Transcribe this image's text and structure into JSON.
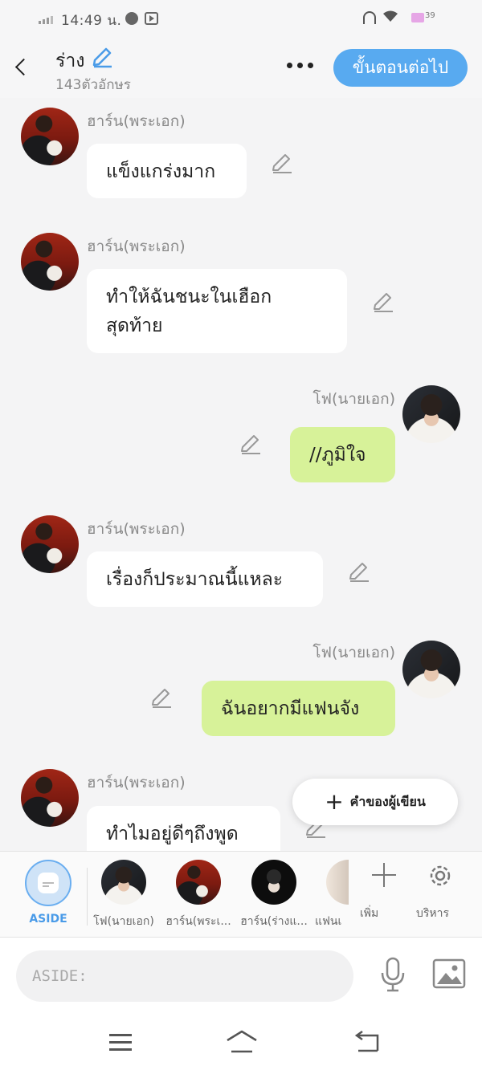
{
  "status_bar": {
    "time": "14:49 น.",
    "battery": "39"
  },
  "header": {
    "title": "ร่าง",
    "subtitle": "143ตัวอักษร",
    "next_button": "ขั้นตอนต่อไป"
  },
  "messages": [
    {
      "side": "left",
      "name": "ฮาร์น(พระเอก)",
      "text": "แข็งแกร่งมาก"
    },
    {
      "side": "left",
      "name": "ฮาร์น(พระเอก)",
      "text": "ทำให้ฉันชนะในเฮือกสุดท้าย"
    },
    {
      "side": "right",
      "name": "โฟ(นายเอก)",
      "text": "//ภูมิใจ"
    },
    {
      "side": "left",
      "name": "ฮาร์น(พระเอก)",
      "text": "เรื่องก็ประมาณนี้แหละ"
    },
    {
      "side": "right",
      "name": "โฟ(นายเอก)",
      "text": "ฉันอยากมีแฟนจัง"
    },
    {
      "side": "left",
      "name": "ฮาร์น(พระเอก)",
      "text": "ทำไมอยู่ดีๆถึงพูด"
    }
  ],
  "float_button": "คำของผู้เขียน",
  "characters": {
    "aside": "ASIDE",
    "items": [
      "โฟ(นายเอก)",
      "ฮาร์น(พระเ...",
      "ฮาร์น(ร่างแ...",
      "แฟนเ"
    ],
    "add_label": "เพิ่ม",
    "manage_label": "บริหาร"
  },
  "input": {
    "placeholder": "ASIDE:"
  },
  "colors": {
    "accent": "#58aaf0",
    "my_bubble": "#d7f299",
    "other_bubble": "#ffffff"
  }
}
